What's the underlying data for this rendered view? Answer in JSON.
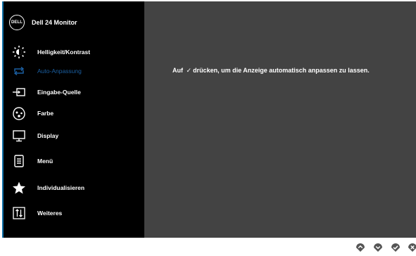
{
  "header": {
    "logo": "DELL",
    "title": "Dell 24 Monitor"
  },
  "menu": {
    "items": [
      {
        "label": "Helligkeit/Kontrast",
        "icon": "brightness-icon",
        "active": false
      },
      {
        "label": "Auto-Anpassung",
        "icon": "auto-adjust-icon",
        "active": true
      },
      {
        "label": "Eingabe-Quelle",
        "icon": "input-source-icon",
        "active": false
      },
      {
        "label": "Farbe",
        "icon": "color-palette-icon",
        "active": false
      },
      {
        "label": "Display",
        "icon": "display-monitor-icon",
        "active": false
      },
      {
        "label": "Menü",
        "icon": "menu-document-icon",
        "active": false
      },
      {
        "label": "Individualisieren",
        "icon": "star-icon",
        "active": false
      },
      {
        "label": "Weiteres",
        "icon": "other-settings-icon",
        "active": false
      }
    ]
  },
  "content": {
    "message_before": "Auf",
    "message_check": "✓",
    "message_after": "drücken, um die Anzeige automatisch anpassen zu lassen."
  },
  "nav_buttons": [
    {
      "icon": "up-arrow-icon"
    },
    {
      "icon": "down-arrow-icon"
    },
    {
      "icon": "checkmark-icon"
    },
    {
      "icon": "close-icon"
    }
  ],
  "colors": {
    "menu_bg": "#000000",
    "content_bg": "#434343",
    "accent": "#1b5fa1",
    "frame_border": "#0f6fa6",
    "nav_button": "#555555"
  }
}
